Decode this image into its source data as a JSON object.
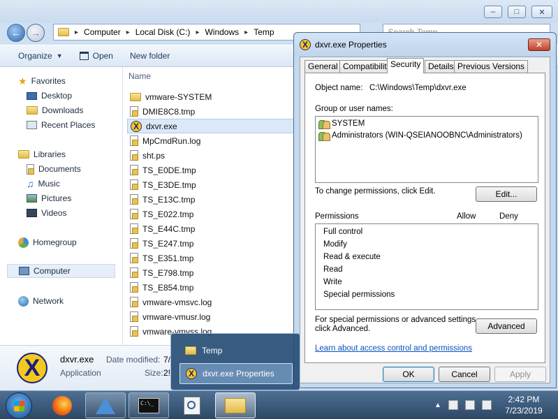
{
  "explorer": {
    "address": {
      "crumbs": [
        "Computer",
        "Local Disk (C:)",
        "Windows",
        "Temp"
      ]
    },
    "search": {
      "placeholder": "Search Temp"
    },
    "toolbar": {
      "organize": "Organize",
      "open": "Open",
      "new_folder": "New folder"
    },
    "nav": {
      "favorites": "Favorites",
      "desktop": "Desktop",
      "downloads": "Downloads",
      "recent_places": "Recent Places",
      "libraries": "Libraries",
      "documents": "Documents",
      "music": "Music",
      "pictures": "Pictures",
      "videos": "Videos",
      "homegroup": "Homegroup",
      "computer": "Computer",
      "network": "Network"
    },
    "column_name": "Name",
    "files": [
      {
        "name": "vmware-SYSTEM",
        "kind": "folder"
      },
      {
        "name": "DMIE8C8.tmp",
        "kind": "file"
      },
      {
        "name": "dxvr.exe",
        "kind": "exe"
      },
      {
        "name": "MpCmdRun.log",
        "kind": "file"
      },
      {
        "name": "sht.ps",
        "kind": "file"
      },
      {
        "name": "TS_E0DE.tmp",
        "kind": "file"
      },
      {
        "name": "TS_E3DE.tmp",
        "kind": "file"
      },
      {
        "name": "TS_E13C.tmp",
        "kind": "file"
      },
      {
        "name": "TS_E022.tmp",
        "kind": "file"
      },
      {
        "name": "TS_E44C.tmp",
        "kind": "file"
      },
      {
        "name": "TS_E247.tmp",
        "kind": "file"
      },
      {
        "name": "TS_E351.tmp",
        "kind": "file"
      },
      {
        "name": "TS_E798.tmp",
        "kind": "file"
      },
      {
        "name": "TS_E854.tmp",
        "kind": "file"
      },
      {
        "name": "vmware-vmsvc.log",
        "kind": "file"
      },
      {
        "name": "vmware-vmusr.log",
        "kind": "file"
      },
      {
        "name": "vmware-vmvss.log",
        "kind": "file"
      }
    ],
    "details": {
      "name": "dxvr.exe",
      "type": "Application",
      "date_modified_label": "Date modified:",
      "date_modified_value": "7/",
      "size_label": "Size:",
      "size_value": "2!"
    }
  },
  "dialog": {
    "title": "dxvr.exe Properties",
    "tabs": [
      "General",
      "Compatibility",
      "Security",
      "Details",
      "Previous Versions"
    ],
    "active_tab": "Security",
    "object_name_label": "Object name:",
    "object_name_value": "C:\\Windows\\Temp\\dxvr.exe",
    "group_label": "Group or user names:",
    "groups": [
      "SYSTEM",
      "Administrators (WIN-QSEIANOOBNC\\Administrators)"
    ],
    "change_perm_text": "To change permissions, click Edit.",
    "edit_button": "Edit...",
    "permissions_label": "Permissions",
    "allow_label": "Allow",
    "deny_label": "Deny",
    "permissions": [
      "Full control",
      "Modify",
      "Read & execute",
      "Read",
      "Write",
      "Special permissions"
    ],
    "special_text_1": "For special permissions or advanced settings,",
    "special_text_2": "click Advanced.",
    "advanced_button": "Advanced",
    "learn_link": "Learn about access control and permissions",
    "ok_button": "OK",
    "cancel_button": "Cancel",
    "apply_button": "Apply"
  },
  "preview": {
    "items": [
      "Temp",
      "dxvr.exe Properties"
    ]
  },
  "taskbar": {
    "time": "2:42 PM",
    "date": "7/23/2019"
  },
  "colors": {
    "accent": "#3c7fb1",
    "link": "#0b52c0",
    "selection": "#dbe8f7",
    "close_red": "#c0412a"
  }
}
